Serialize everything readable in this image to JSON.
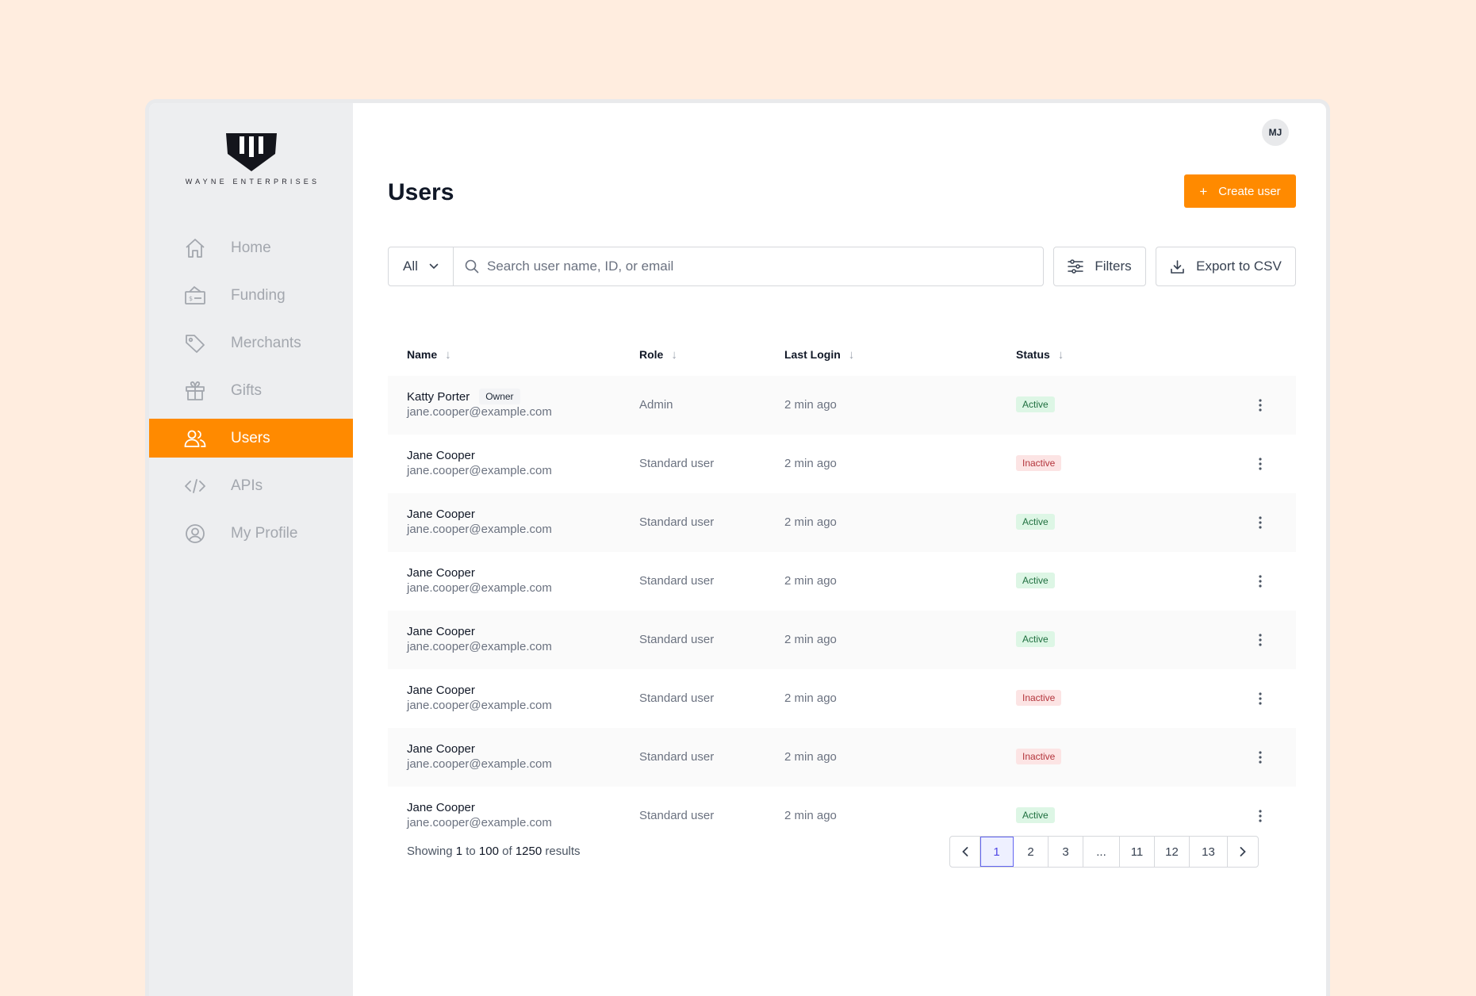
{
  "brand": {
    "name": "WAYNE ENTERPRISES"
  },
  "nav": {
    "items": [
      {
        "label": "Home",
        "icon": "home-icon"
      },
      {
        "label": "Funding",
        "icon": "funding-icon"
      },
      {
        "label": "Merchants",
        "icon": "tag-icon"
      },
      {
        "label": "Gifts",
        "icon": "gift-icon"
      },
      {
        "label": "Users",
        "icon": "users-icon",
        "active": true
      },
      {
        "label": "APIs",
        "icon": "code-icon"
      },
      {
        "label": "My Profile",
        "icon": "profile-icon"
      }
    ]
  },
  "header": {
    "avatar_initials": "MJ",
    "title": "Users",
    "create_label": "Create user"
  },
  "toolbar": {
    "scope_value": "All",
    "search_placeholder": "Search user name, ID, or email",
    "filters_label": "Filters",
    "export_label": "Export to CSV"
  },
  "table": {
    "columns": [
      "Name",
      "Role",
      "Last Login",
      "Status"
    ],
    "owner_tag": "Owner",
    "rows": [
      {
        "name": "Katty Porter",
        "owner": true,
        "email": "jane.cooper@example.com",
        "role": "Admin",
        "last_login": "2 min ago",
        "status": "Active"
      },
      {
        "name": "Jane Cooper",
        "owner": false,
        "email": "jane.cooper@example.com",
        "role": "Standard user",
        "last_login": "2 min ago",
        "status": "Inactive"
      },
      {
        "name": "Jane Cooper",
        "owner": false,
        "email": "jane.cooper@example.com",
        "role": "Standard user",
        "last_login": "2 min ago",
        "status": "Active"
      },
      {
        "name": "Jane Cooper",
        "owner": false,
        "email": "jane.cooper@example.com",
        "role": "Standard user",
        "last_login": "2 min ago",
        "status": "Active"
      },
      {
        "name": "Jane Cooper",
        "owner": false,
        "email": "jane.cooper@example.com",
        "role": "Standard user",
        "last_login": "2 min ago",
        "status": "Active"
      },
      {
        "name": "Jane Cooper",
        "owner": false,
        "email": "jane.cooper@example.com",
        "role": "Standard user",
        "last_login": "2 min ago",
        "status": "Inactive"
      },
      {
        "name": "Jane Cooper",
        "owner": false,
        "email": "jane.cooper@example.com",
        "role": "Standard user",
        "last_login": "2 min ago",
        "status": "Inactive"
      },
      {
        "name": "Jane Cooper",
        "owner": false,
        "email": "jane.cooper@example.com",
        "role": "Standard user",
        "last_login": "2 min ago",
        "status": "Active"
      }
    ]
  },
  "pagination": {
    "showing_prefix": "Showing",
    "from": "1",
    "to_word": "to",
    "to": "100",
    "of_word": "of",
    "total": "1250",
    "results_word": "results",
    "pages": [
      "1",
      "2",
      "3",
      "...",
      "11",
      "12",
      "13"
    ],
    "current": "1"
  },
  "colors": {
    "accent": "#FF8A00",
    "page_bg": "#FFEDDF",
    "sidebar_bg": "#EDEEF0",
    "active_badge": "#DDF6E5",
    "inactive_badge": "#FCE4E4"
  }
}
